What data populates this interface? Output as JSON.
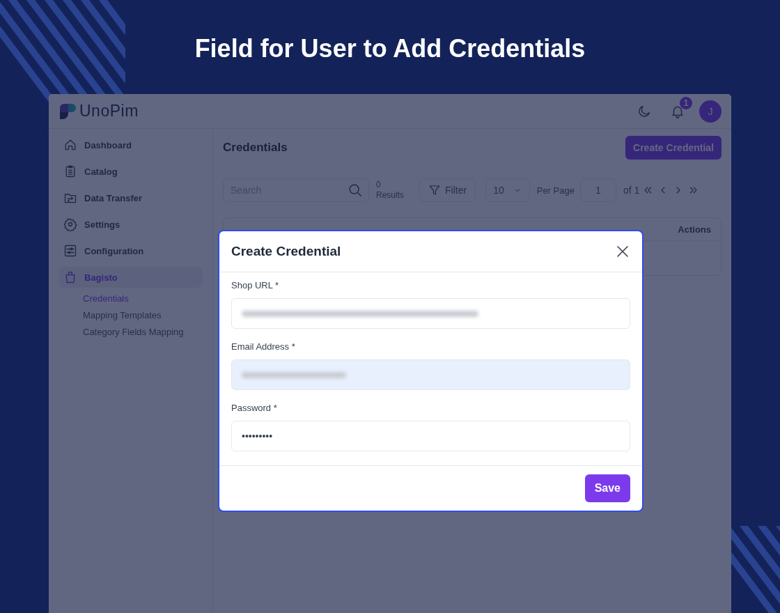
{
  "page_title": "Field for User to Add Credentials",
  "app": {
    "logo": "UnoPim",
    "notifications_count": "1",
    "avatar_initial": "J",
    "sidebar": [
      {
        "label": "Dashboard",
        "selected": false
      },
      {
        "label": "Catalog",
        "selected": false
      },
      {
        "label": "Data Transfer",
        "selected": false
      },
      {
        "label": "Settings",
        "selected": false
      },
      {
        "label": "Configuration",
        "selected": false
      },
      {
        "label": "Bagisto",
        "selected": true,
        "children": [
          {
            "label": "Credentials",
            "selected": true
          },
          {
            "label": "Mapping Templates",
            "selected": false
          },
          {
            "label": "Category Fields Mapping",
            "selected": false
          }
        ]
      }
    ],
    "content": {
      "title": "Credentials",
      "create_button": "Create Credential",
      "search_placeholder": "Search",
      "results_count": "0",
      "results_label": "Results",
      "filter_button": "Filter",
      "per_page_value": "10",
      "per_page_label": "Per Page",
      "page_number": "1",
      "page_total": "of 1",
      "table": {
        "columns": [
          "Actions"
        ]
      }
    }
  },
  "modal": {
    "title": "Create Credential",
    "fields": [
      {
        "label": "Shop URL *",
        "kind": "url"
      },
      {
        "label": "Email Address *",
        "kind": "email"
      },
      {
        "label": "Password *",
        "kind": "password",
        "value": "•••••••••"
      }
    ],
    "save_button": "Save"
  }
}
